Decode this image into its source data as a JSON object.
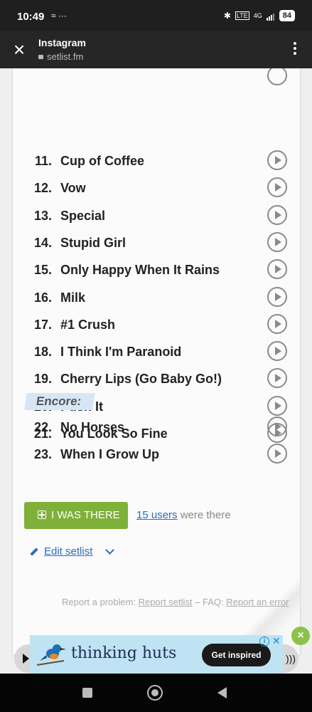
{
  "status_bar": {
    "time": "10:49",
    "notif_icons": "≈ ···",
    "network": "4G",
    "lte": "LTE",
    "battery": "84"
  },
  "header": {
    "title": "Instagram",
    "url": "setlist.fm"
  },
  "setlist": {
    "songs": [
      {
        "num": "11.",
        "title": "Cup of Coffee"
      },
      {
        "num": "12.",
        "title": "Vow"
      },
      {
        "num": "13.",
        "title": "Special"
      },
      {
        "num": "14.",
        "title": "Stupid Girl"
      },
      {
        "num": "15.",
        "title": "Only Happy When It Rains"
      },
      {
        "num": "16.",
        "title": "Milk"
      },
      {
        "num": "17.",
        "title": "#1 Crush"
      },
      {
        "num": "18.",
        "title": "I Think I'm Paranoid"
      },
      {
        "num": "19.",
        "title": "Cherry Lips (Go Baby Go!)"
      },
      {
        "num": "20.",
        "title": "Push It"
      },
      {
        "num": "21.",
        "title": "You Look So Fine"
      }
    ],
    "encore_label": "Encore:",
    "encore_songs": [
      {
        "num": "22.",
        "title": "No Horses"
      },
      {
        "num": "23.",
        "title": "When I Grow Up"
      }
    ]
  },
  "attendance": {
    "button_label": "I WAS THERE",
    "users_link": "15 users",
    "users_suffix": " were there"
  },
  "edit": {
    "label": "Edit setlist"
  },
  "report": {
    "prefix": "Report a problem: ",
    "report_link": "Report setlist",
    "faq_prefix": " – FAQ: ",
    "faq_link": "Report an error"
  },
  "ad": {
    "brand_text": "thinking huts",
    "cta": "Get inspired",
    "info": "i",
    "close": "✕"
  },
  "colors": {
    "accent_green": "#7fb03a",
    "link_blue": "#2a6ebb",
    "encore_highlight": "#d7e6f7"
  }
}
